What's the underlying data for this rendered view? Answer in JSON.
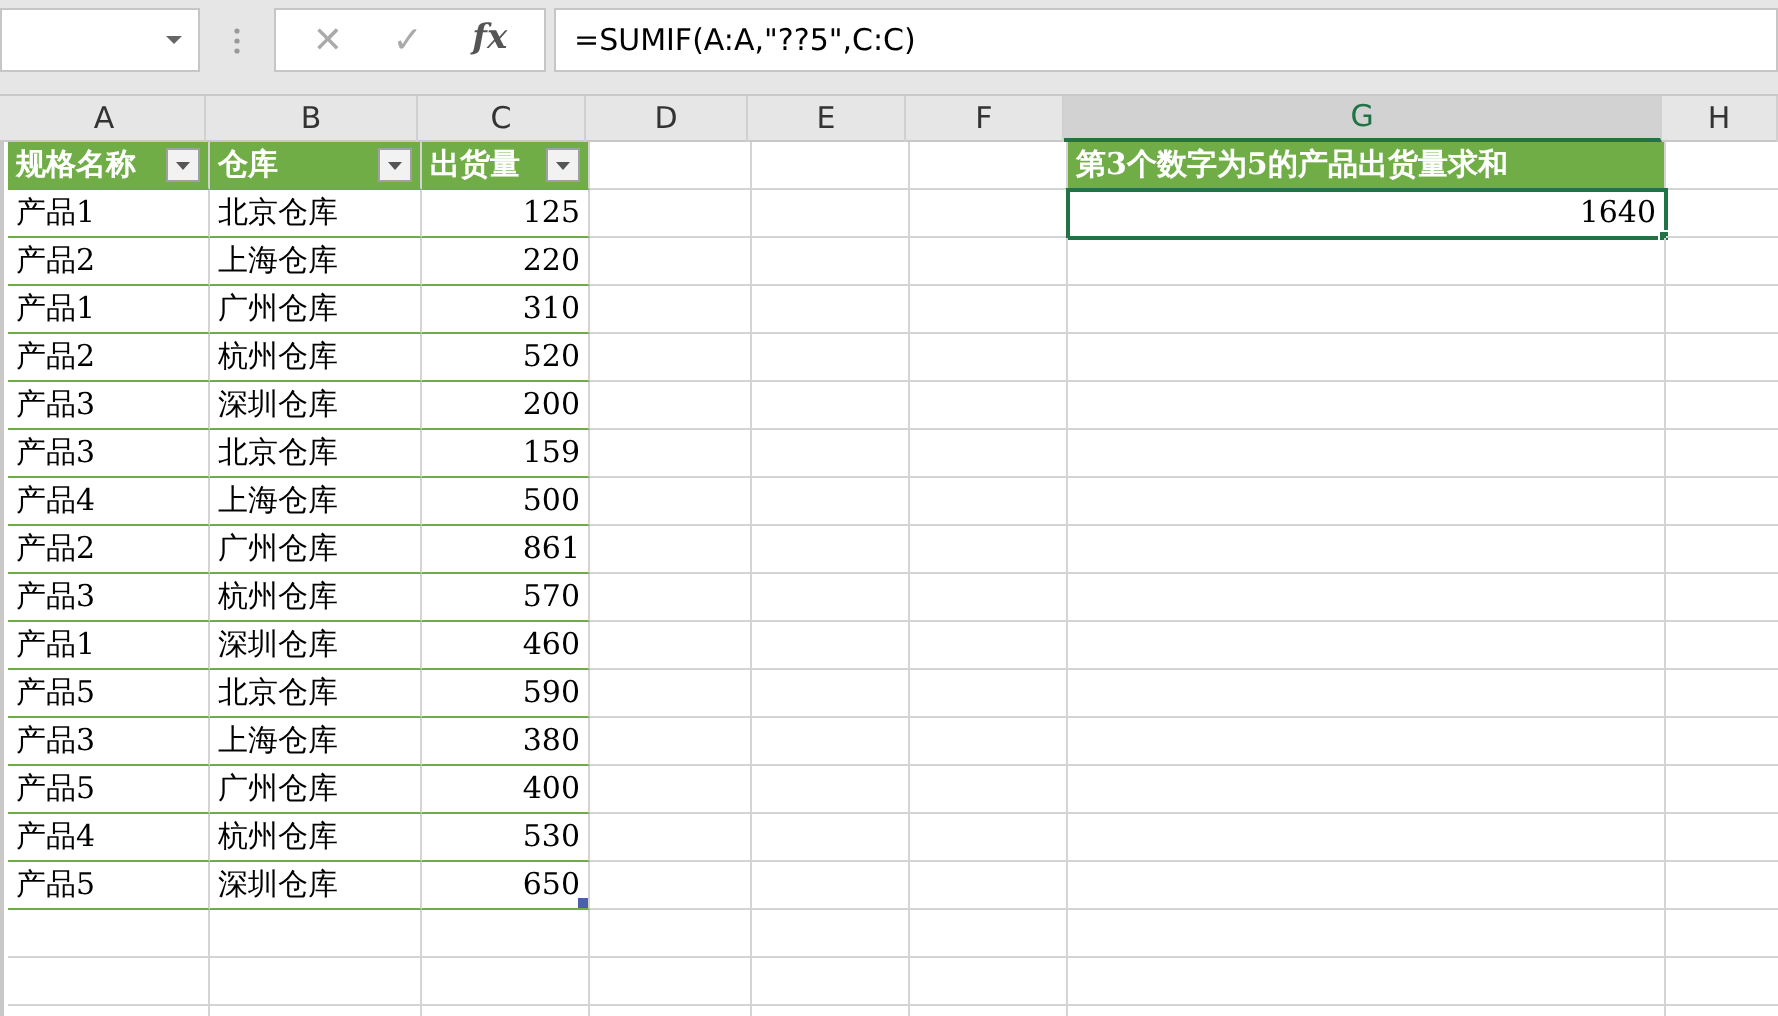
{
  "formula_bar": {
    "cancel_symbol": "✕",
    "enter_symbol": "✓",
    "function_symbol": "fx",
    "formula": "=SUMIF(A:A,\"??5\",C:C)"
  },
  "columns": [
    {
      "label": "A",
      "selected": false
    },
    {
      "label": "B",
      "selected": false
    },
    {
      "label": "C",
      "selected": false
    },
    {
      "label": "D",
      "selected": false
    },
    {
      "label": "E",
      "selected": false
    },
    {
      "label": "F",
      "selected": false
    },
    {
      "label": "G",
      "selected": true
    },
    {
      "label": "H",
      "selected": false
    }
  ],
  "table": {
    "headers": [
      "规格名称",
      "仓库",
      "出货量"
    ],
    "rows": [
      [
        "产品1",
        "北京仓库",
        "125"
      ],
      [
        "产品2",
        "上海仓库",
        "220"
      ],
      [
        "产品1",
        "广州仓库",
        "310"
      ],
      [
        "产品2",
        "杭州仓库",
        "520"
      ],
      [
        "产品3",
        "深圳仓库",
        "200"
      ],
      [
        "产品3",
        "北京仓库",
        "159"
      ],
      [
        "产品4",
        "上海仓库",
        "500"
      ],
      [
        "产品2",
        "广州仓库",
        "861"
      ],
      [
        "产品3",
        "杭州仓库",
        "570"
      ],
      [
        "产品1",
        "深圳仓库",
        "460"
      ],
      [
        "产品5",
        "北京仓库",
        "590"
      ],
      [
        "产品3",
        "上海仓库",
        "380"
      ],
      [
        "产品5",
        "广州仓库",
        "400"
      ],
      [
        "产品4",
        "杭州仓库",
        "530"
      ],
      [
        "产品5",
        "深圳仓库",
        "650"
      ]
    ]
  },
  "result": {
    "label": "第3个数字为5的产品出货量求和",
    "value": "1640",
    "selected": true
  }
}
